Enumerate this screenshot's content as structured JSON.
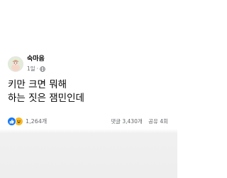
{
  "post": {
    "author": "숙마음",
    "time": "1일",
    "separator": "·",
    "privacy_icon": "globe-icon",
    "text_lines": [
      "키만 크면 뭐해",
      "하는 짓은 잼민인데"
    ],
    "reactions": {
      "icons": [
        "like-icon",
        "haha-icon"
      ],
      "count": "1,264개"
    },
    "comments": "댓글 3,430개",
    "shares": "공유 4회"
  },
  "colors": {
    "like": "#1877f2",
    "haha": "#f7b928",
    "secondary_text": "#65676b",
    "primary_text": "#050505"
  }
}
